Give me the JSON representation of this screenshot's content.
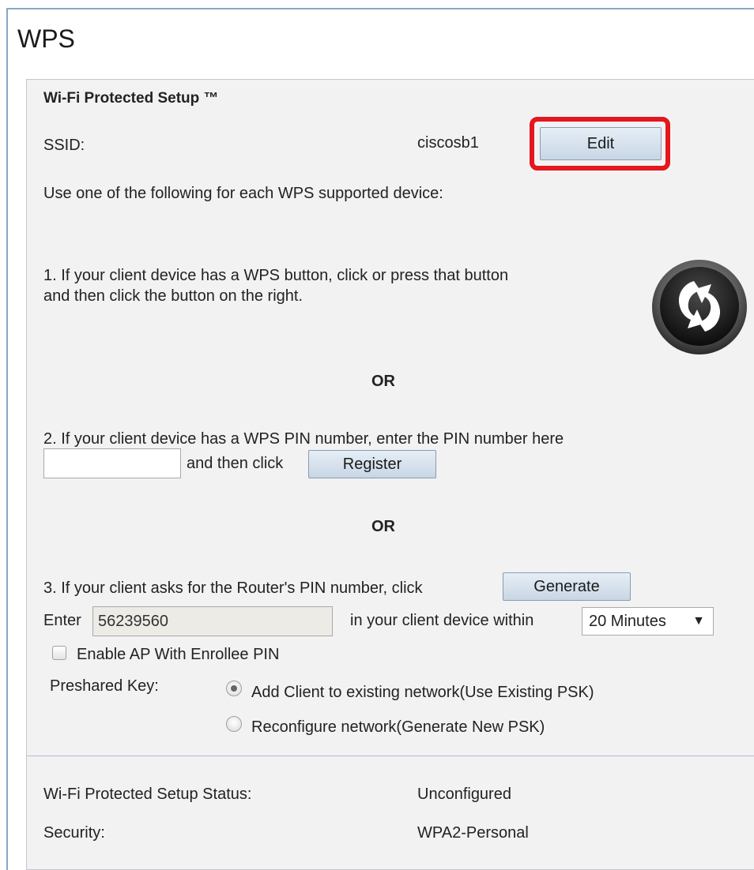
{
  "page": {
    "title": "WPS"
  },
  "section": {
    "title": "Wi-Fi Protected Setup ™"
  },
  "ssid": {
    "label": "SSID:",
    "value": "ciscosb1",
    "edit_label": "Edit"
  },
  "intro": "Use one of the following for each WPS supported device:",
  "method1": {
    "line1": "1. If your client device has a WPS button, click or press that button",
    "line2": "and then click the button on the right.",
    "icon": "wps-push-button-icon"
  },
  "or_label": "OR",
  "method2": {
    "text": "2. If your client device has a WPS PIN number, enter the PIN number here",
    "pin_value": "",
    "then_text": "and then click",
    "register_label": "Register"
  },
  "method3": {
    "text": "3. If your client asks for the Router's PIN number, click",
    "generate_label": "Generate",
    "enter_label": "Enter",
    "pin": "56239560",
    "within_text": "in your client device within",
    "duration": "20 Minutes",
    "enable_ap_label": "Enable AP With Enrollee PIN",
    "enable_ap_checked": false,
    "preshared_label": "Preshared Key:",
    "options": [
      {
        "label": "Add Client to existing network(Use Existing PSK)",
        "selected": true
      },
      {
        "label": "Reconfigure network(Generate New PSK)",
        "selected": false
      }
    ]
  },
  "status": {
    "wps_label": "Wi-Fi Protected Setup Status:",
    "wps_value": "Unconfigured",
    "security_label": "Security:",
    "security_value": "WPA2-Personal"
  },
  "colors": {
    "highlight": "#e4161e",
    "button_top": "#e6eef6",
    "button_bottom": "#c8d6e5",
    "panel": "#f2f2f2"
  }
}
